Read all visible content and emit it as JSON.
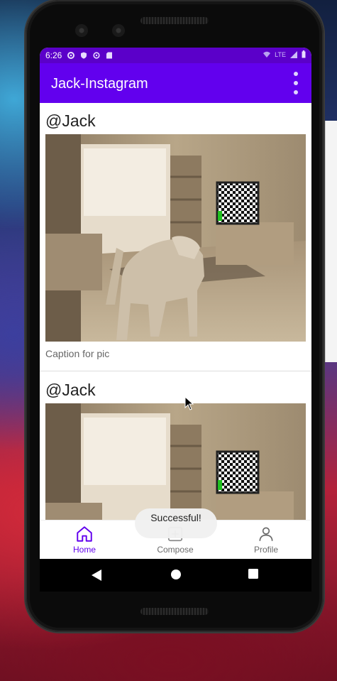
{
  "status_bar": {
    "time": "6:26",
    "network": "LTE",
    "icons_left": [
      "settings-icon",
      "shield-icon",
      "sync-icon",
      "sd-card-icon"
    ],
    "icons_right": [
      "wifi-icon",
      "signal-icon",
      "battery-icon"
    ]
  },
  "app_bar": {
    "title": "Jack-Instagram",
    "overflow_icon": "more-vert-icon"
  },
  "feed": {
    "posts": [
      {
        "username": "@Jack",
        "caption": "Caption for pic"
      },
      {
        "username": "@Jack",
        "caption": ""
      }
    ]
  },
  "toast": {
    "message": "Successful!"
  },
  "bottom_nav": {
    "items": [
      {
        "label": "Home",
        "icon": "home-icon",
        "active": true
      },
      {
        "label": "Compose",
        "icon": "add-box-icon",
        "active": false
      },
      {
        "label": "Profile",
        "icon": "person-icon",
        "active": false
      }
    ]
  },
  "colors": {
    "primary": "#6200ee",
    "primary_dark": "#5b00c9",
    "background": "#ffffff"
  }
}
